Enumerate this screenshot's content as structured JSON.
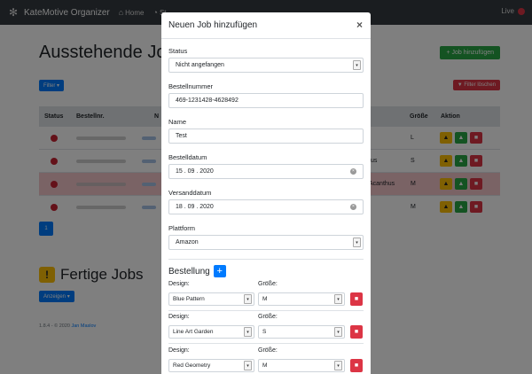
{
  "navbar": {
    "brand": "KateMotive Organizer",
    "home": "Home",
    "stats": "St",
    "live": "Live"
  },
  "page": {
    "pending_title": "Ausstehende Job",
    "add_job": "+ Job hinzufügen",
    "filter": "Filter",
    "filter_clear": "Filter löschen",
    "columns": {
      "status": "Status",
      "order": "Bestellnr.",
      "name": "N",
      "size": "Größe",
      "action": "Aktion"
    },
    "rows": [
      {
        "size": "L",
        "platform": "",
        "highlight": false
      },
      {
        "size": "S",
        "platform": "tus",
        "highlight": false
      },
      {
        "size": "M",
        "platform": "Acanthus",
        "highlight": true
      },
      {
        "size": "M",
        "platform": "",
        "highlight": false
      }
    ],
    "page_num": "1",
    "done_title": "Fertige Jobs",
    "show": "Anzeigen",
    "footer_text": "1.8.4 - © 2020",
    "footer_author": "Jan Maslov"
  },
  "modal": {
    "title": "Neuen Job hinzufügen",
    "close": "×",
    "status_label": "Status",
    "status_value": "Nicht angefangen",
    "order_label": "Bestellnummer",
    "order_value": "469-1231428-4628492",
    "name_label": "Name",
    "name_value": "Test",
    "order_date_label": "Bestelldatum",
    "order_date_value": "15 . 09 . 2020",
    "ship_date_label": "Versanddatum",
    "ship_date_value": "18 . 09 . 2020",
    "platform_label": "Plattform",
    "platform_value": "Amazon",
    "order_section": "Bestellung",
    "design_label": "Design:",
    "size_label": "Größe:",
    "items": [
      {
        "design": "Blue Pattern",
        "size": "M"
      },
      {
        "design": "Line Art Garden",
        "size": "S"
      },
      {
        "design": "Red Geometry",
        "size": "M"
      }
    ]
  },
  "colors": {
    "primary": "#007bff",
    "success": "#28a745",
    "danger": "#dc3545",
    "warning": "#ffc107",
    "navbar": "#343a40"
  }
}
